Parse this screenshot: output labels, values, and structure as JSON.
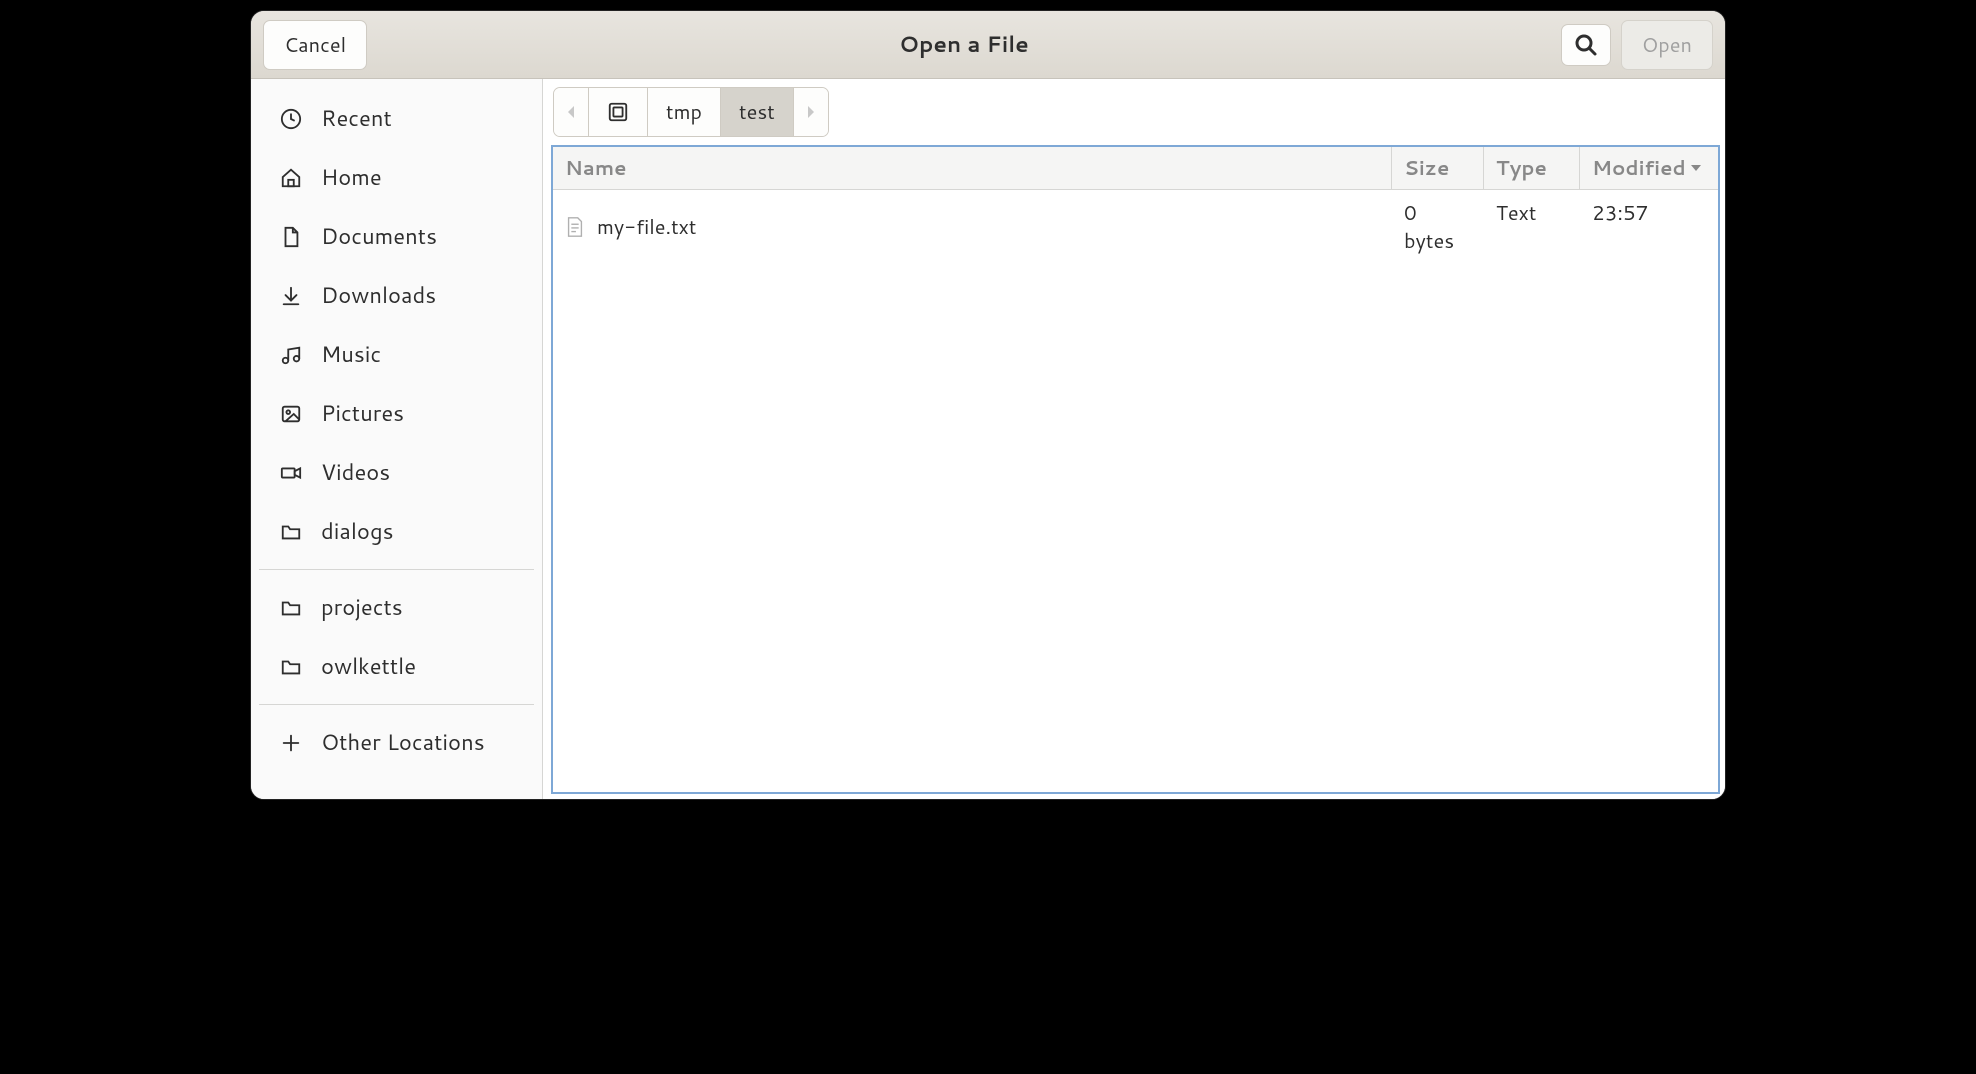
{
  "titlebar": {
    "cancel": "Cancel",
    "title": "Open a File",
    "open": "Open"
  },
  "sidebar": {
    "places": [
      {
        "icon": "clock",
        "label": "Recent"
      },
      {
        "icon": "home",
        "label": "Home"
      },
      {
        "icon": "documents",
        "label": "Documents"
      },
      {
        "icon": "downloads",
        "label": "Downloads"
      },
      {
        "icon": "music",
        "label": "Music"
      },
      {
        "icon": "pictures",
        "label": "Pictures"
      },
      {
        "icon": "videos",
        "label": "Videos"
      },
      {
        "icon": "folder",
        "label": "dialogs"
      }
    ],
    "bookmarks": [
      {
        "icon": "folder",
        "label": "projects"
      },
      {
        "icon": "folder",
        "label": "owlkettle"
      }
    ],
    "other": {
      "icon": "plus",
      "label": "Other Locations"
    }
  },
  "pathbar": {
    "segments": [
      "tmp",
      "test"
    ],
    "active_index": 1
  },
  "columns": {
    "name": "Name",
    "size": "Size",
    "type": "Type",
    "modified": "Modified"
  },
  "files": [
    {
      "name": "my-file.txt",
      "size": "0 bytes",
      "type": "Text",
      "modified": "23:57"
    }
  ]
}
